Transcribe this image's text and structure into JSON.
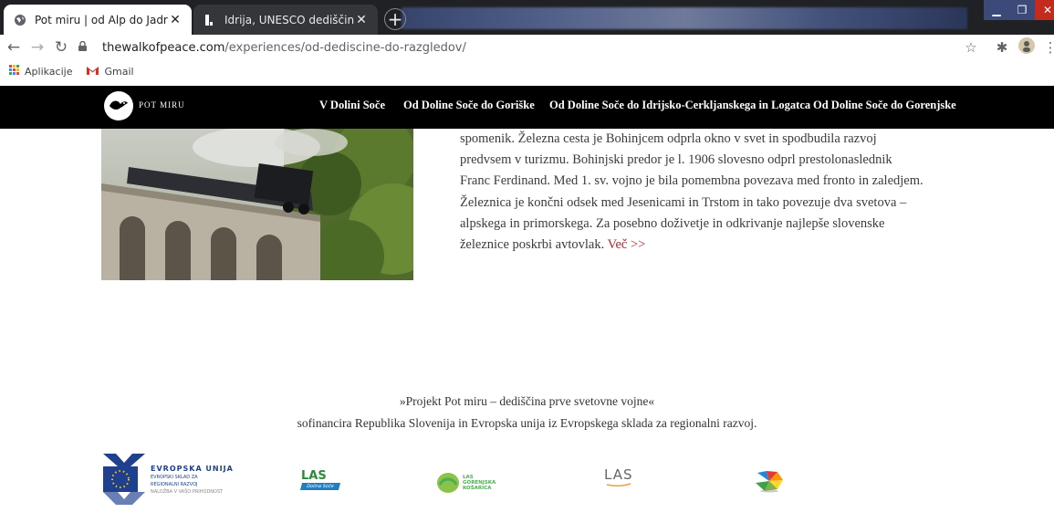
{
  "browser": {
    "tabs": [
      {
        "title": "Pot miru | od Alp do Jadrana",
        "active": true
      },
      {
        "title": "Idrija, UNESCO dediščina",
        "active": false
      }
    ],
    "url_host": "thewalkofpeace.com",
    "url_path": "/experiences/od-dediscine-do-razgledov/",
    "bookmarks": [
      {
        "label": "Aplikacije",
        "icon": "apps-grid-icon"
      },
      {
        "label": "Gmail",
        "icon": "gmail-icon"
      }
    ]
  },
  "site": {
    "logo_text": "POT MIRU",
    "menu": [
      "V Dolini Soče",
      "Od Doline Soče do Goriške",
      "Od Doline Soče do Idrijsko-Cerkljanskega in Logatca",
      "Od Doline Soče do Gorenjske"
    ]
  },
  "article": {
    "lines": [
      "spomenik. Železna cesta je Bohinjcem odprla okno v svet in spodbudila razvoj",
      "predvsem v turizmu. Bohinjski predor je l. 1906 slovesno odprl prestolonaslednik",
      "Franc Ferdinand. Med 1. sv. vojno je bila pomembna povezava med fronto in zaledjem.",
      "Železnica je končni odsek med Jesenicami in Trstom in tako povezuje dva svetova –",
      "alpskega in primorskega. Za posebno doživetje in odkrivanje najlepše slovenske",
      "železnice poskrbi avtovlak."
    ],
    "more_link": "Več >>"
  },
  "footer": {
    "line1": "»Projekt Pot miru – dediščina prve svetovne vojne«",
    "line2": "sofinancira Republika Slovenija in Evropska unija iz Evropskega sklada za regionalni razvoj."
  },
  "sponsors": {
    "eu_title": "EVROPSKA UNIJA",
    "eu_sub1": "EVROPSKI SKLAD ZA",
    "eu_sub2": "REGIONALNI RAZVOJ",
    "eu_sub3": "NALOŽBA V VAŠO PRIHODNOST",
    "las1": "LAS",
    "las1_sub": "Dolina Soče",
    "las2_a": "LAS",
    "las2_b": "GORENJSKA",
    "las2_c": "KOŠARICA",
    "las3": "LAS"
  },
  "colors": {
    "header_bg": "#000000",
    "link": "#b0262f",
    "eu_blue": "#1f3f8f"
  }
}
